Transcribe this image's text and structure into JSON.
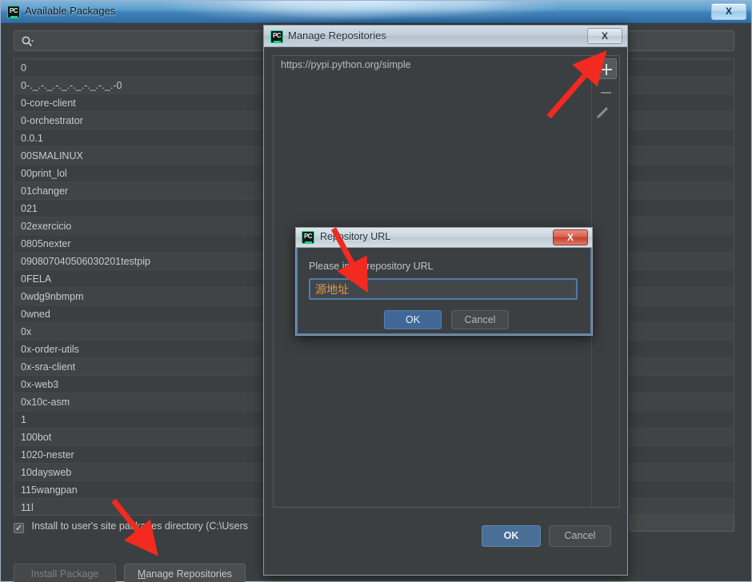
{
  "main_window": {
    "title": "Available Packages",
    "icon": "pycharm-icon",
    "close_label": "X",
    "search": {
      "placeholder": "",
      "value": "",
      "icon": "search-icon"
    },
    "packages": [
      "0",
      "0-._.-._.-._.-._.-._.-._.-0",
      "0-core-client",
      "0-orchestrator",
      "0.0.1",
      "00SMALINUX",
      "00print_lol",
      "01changer",
      "021",
      "02exercicio",
      "0805nexter",
      "090807040506030201testpip",
      "0FELA",
      "0wdg9nbmpm",
      "0wned",
      "0x",
      "0x-order-utils",
      "0x-sra-client",
      "0x-web3",
      "0x10c-asm",
      "1",
      "100bot",
      "1020-nester",
      "10daysweb",
      "115wangpan",
      "11l"
    ],
    "checkbox": {
      "checked": true,
      "check_glyph": "✓",
      "label": "Install to user's site packages directory (C:\\Users"
    },
    "buttons": {
      "install_package": "Install Package",
      "install_package_enabled": false,
      "manage_repositories_mnemonic": "M",
      "manage_repositories_rest": "anage Repositories"
    }
  },
  "repo_window": {
    "title": "Manage Repositories",
    "icon": "pycharm-icon",
    "close_label": "X",
    "repositories": [
      "https://pypi.python.org/simple"
    ],
    "tools": [
      {
        "name": "add-repository-button",
        "icon": "plus-icon",
        "enabled": true
      },
      {
        "name": "remove-repository-button",
        "icon": "minus-icon",
        "enabled": false
      },
      {
        "name": "edit-repository-button",
        "icon": "pencil-icon",
        "enabled": false
      }
    ],
    "ok_label": "OK",
    "cancel_label": "Cancel"
  },
  "url_dialog": {
    "title": "Repository URL",
    "icon": "pycharm-icon",
    "close_label": "X",
    "prompt": "Please input repository URL",
    "input": {
      "value": "源地址",
      "placeholder": ""
    },
    "ok_label": "OK",
    "cancel_label": "Cancel"
  },
  "annotations": {
    "arrow_color": "#f22a20",
    "arrows": [
      {
        "name": "arrow-to-add-repository",
        "points_to": "add-repository-button"
      },
      {
        "name": "arrow-to-url-input",
        "points_to": "repository-url-input"
      },
      {
        "name": "arrow-to-manage-repositories",
        "points_to": "manage-repositories-button"
      }
    ]
  },
  "colors": {
    "panel_bg": "#3c3f41",
    "accent_blue": "#4a6f96",
    "input_text": "#d99a53",
    "title_gradient": "#5f9fce"
  }
}
